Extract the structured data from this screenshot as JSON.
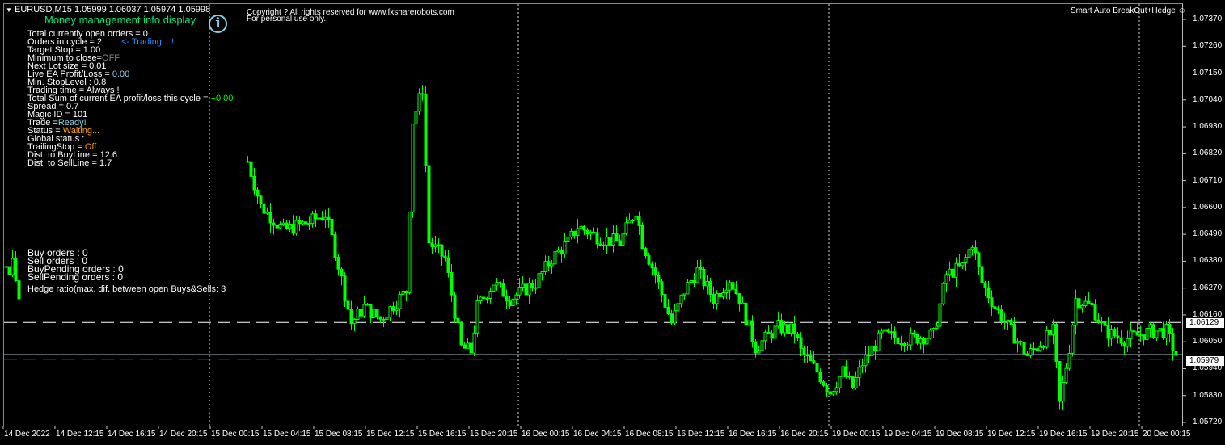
{
  "header": {
    "symbol_line": "EURUSD,M15  1.05999 1.06037 1.05974 1.05998"
  },
  "copyright": {
    "line1": "Copyright ? All rights reserved for www.fxsharerobots.com",
    "line2": "For personal use only."
  },
  "ea_name": "Smart Auto BreakOut+Hedge",
  "panel": {
    "title": "Money management info display",
    "lines": [
      {
        "label": "Total currently open orders = 0",
        "value": "",
        "value_color": "#ffffff"
      },
      {
        "label": "Orders in cycle = 2",
        "value": "<- Trading... !",
        "value_color": "#1e90ff"
      },
      {
        "label": "Target Stop = 1.00",
        "value": "",
        "value_color": "#ffffff"
      },
      {
        "label": "Minimum to close=",
        "value": "OFF",
        "value_color": "#808080"
      },
      {
        "label": "Next Lot size = 0.01",
        "value": "",
        "value_color": "#ffffff"
      },
      {
        "label": "Live EA Profit/Loss = ",
        "value": "0.00",
        "value_color": "#87ceeb"
      },
      {
        "label": "Min. StopLevel : 0.8",
        "value": "",
        "value_color": "#ffffff"
      },
      {
        "label": "Trading time = Always !",
        "value": "",
        "value_color": "#ffffff"
      },
      {
        "label": "Total Sum of current EA profit/loss this cycle = ",
        "value": "+0.00",
        "value_color": "#00ff00"
      },
      {
        "label": "Spread = 0.7",
        "value": "",
        "value_color": "#ffffff"
      },
      {
        "label": "Magic ID = 101",
        "value": "",
        "value_color": "#ffffff"
      },
      {
        "label": "Trade =",
        "value": "Ready!",
        "value_color": "#87ceeb"
      },
      {
        "label": "Status = ",
        "value": "Waiting...",
        "value_color": "#ff9900"
      },
      {
        "label": "Global status :",
        "value": "",
        "value_color": "#ffffff"
      },
      {
        "label": "TrailingStop = ",
        "value": "Off",
        "value_color": "#ff9900"
      },
      {
        "label": "Dist. to BuyLine = 12.6",
        "value": "",
        "value_color": "#ffffff"
      },
      {
        "label": "Dist. to SellLine = 1.7",
        "value": "",
        "value_color": "#ffffff"
      }
    ]
  },
  "orders": {
    "buy": "Buy orders : 0",
    "sell": "Sell orders : 0",
    "buy_pending": "BuyPending orders : 0",
    "sell_pending": "SellPending orders : 0",
    "hedge_ratio": "Hedge ratio(max. dif. between open Buys&Sells: 3"
  },
  "colors": {
    "candle": "#00ff00",
    "title": "#00e676",
    "info_icon": "#87ceeb"
  },
  "chart_data": {
    "type": "candlestick",
    "symbol": "EURUSD",
    "timeframe": "M15",
    "ylim": [
      1.0572,
      1.0737
    ],
    "price_ticks": [
      "1.07370",
      "1.07260",
      "1.07150",
      "1.07040",
      "1.06930",
      "1.06820",
      "1.06710",
      "1.06600",
      "1.06490",
      "1.06380",
      "1.06270",
      "1.06160",
      "1.06050",
      "1.05940",
      "1.05830",
      "1.05720"
    ],
    "time_ticks": [
      "14 Dec 2022",
      "14 Dec 12:15",
      "14 Dec 16:15",
      "14 Dec 20:15",
      "15 Dec 00:15",
      "15 Dec 04:15",
      "15 Dec 08:15",
      "15 Dec 12:15",
      "15 Dec 16:15",
      "15 Dec 20:15",
      "16 Dec 00:15",
      "16 Dec 04:15",
      "16 Dec 08:15",
      "16 Dec 12:15",
      "16 Dec 16:15",
      "16 Dec 20:15",
      "19 Dec 00:15",
      "19 Dec 04:15",
      "19 Dec 08:15",
      "19 Dec 12:15",
      "19 Dec 16:15",
      "19 Dec 20:15",
      "20 Dec 00:15"
    ],
    "buy_line": "1.06129",
    "sell_line": "1.05979",
    "bid": "1.05998",
    "left_fragment_closes": [
      1.06358,
      1.06325,
      1.06391,
      1.063,
      1.06226
    ],
    "close_keypoints": [
      [
        0,
        1.06788
      ],
      [
        4,
        1.06606
      ],
      [
        11,
        1.06507
      ],
      [
        19,
        1.0654
      ],
      [
        24,
        1.06573
      ],
      [
        27,
        1.06424
      ],
      [
        32,
        1.06127
      ],
      [
        36,
        1.06193
      ],
      [
        41,
        1.06143
      ],
      [
        49,
        1.06259
      ],
      [
        51,
        1.06953
      ],
      [
        54,
        1.07086
      ],
      [
        56,
        1.06457
      ],
      [
        61,
        1.06391
      ],
      [
        66,
        1.06027
      ],
      [
        69,
        1.06011
      ],
      [
        71,
        1.06193
      ],
      [
        76,
        1.06292
      ],
      [
        81,
        1.06226
      ],
      [
        89,
        1.06292
      ],
      [
        94,
        1.06391
      ],
      [
        99,
        1.06457
      ],
      [
        102,
        1.06523
      ],
      [
        109,
        1.06474
      ],
      [
        115,
        1.06457
      ],
      [
        120,
        1.0659
      ],
      [
        122,
        1.06457
      ],
      [
        126,
        1.06325
      ],
      [
        131,
        1.06127
      ],
      [
        135,
        1.06259
      ],
      [
        139,
        1.06342
      ],
      [
        144,
        1.06226
      ],
      [
        149,
        1.06308
      ],
      [
        152,
        1.06226
      ],
      [
        157,
        1.06027
      ],
      [
        164,
        1.0611
      ],
      [
        169,
        1.06093
      ],
      [
        171,
        1.06011
      ],
      [
        176,
        1.05928
      ],
      [
        180,
        1.05845
      ],
      [
        184,
        1.05928
      ],
      [
        187,
        1.05862
      ],
      [
        190,
        1.05961
      ],
      [
        196,
        1.06077
      ],
      [
        204,
        1.0606
      ],
      [
        212,
        1.06077
      ],
      [
        216,
        1.06325
      ],
      [
        221,
        1.06358
      ],
      [
        224,
        1.06457
      ],
      [
        227,
        1.06292
      ],
      [
        231,
        1.06193
      ],
      [
        236,
        1.06093
      ],
      [
        241,
        1.05994
      ],
      [
        249,
        1.06093
      ],
      [
        251,
        1.05796
      ],
      [
        254,
        1.06027
      ],
      [
        256,
        1.06226
      ],
      [
        261,
        1.06193
      ],
      [
        265,
        1.06093
      ],
      [
        271,
        1.0606
      ],
      [
        279,
        1.06093
      ],
      [
        284,
        1.06093
      ],
      [
        287,
        1.05994
      ]
    ]
  }
}
